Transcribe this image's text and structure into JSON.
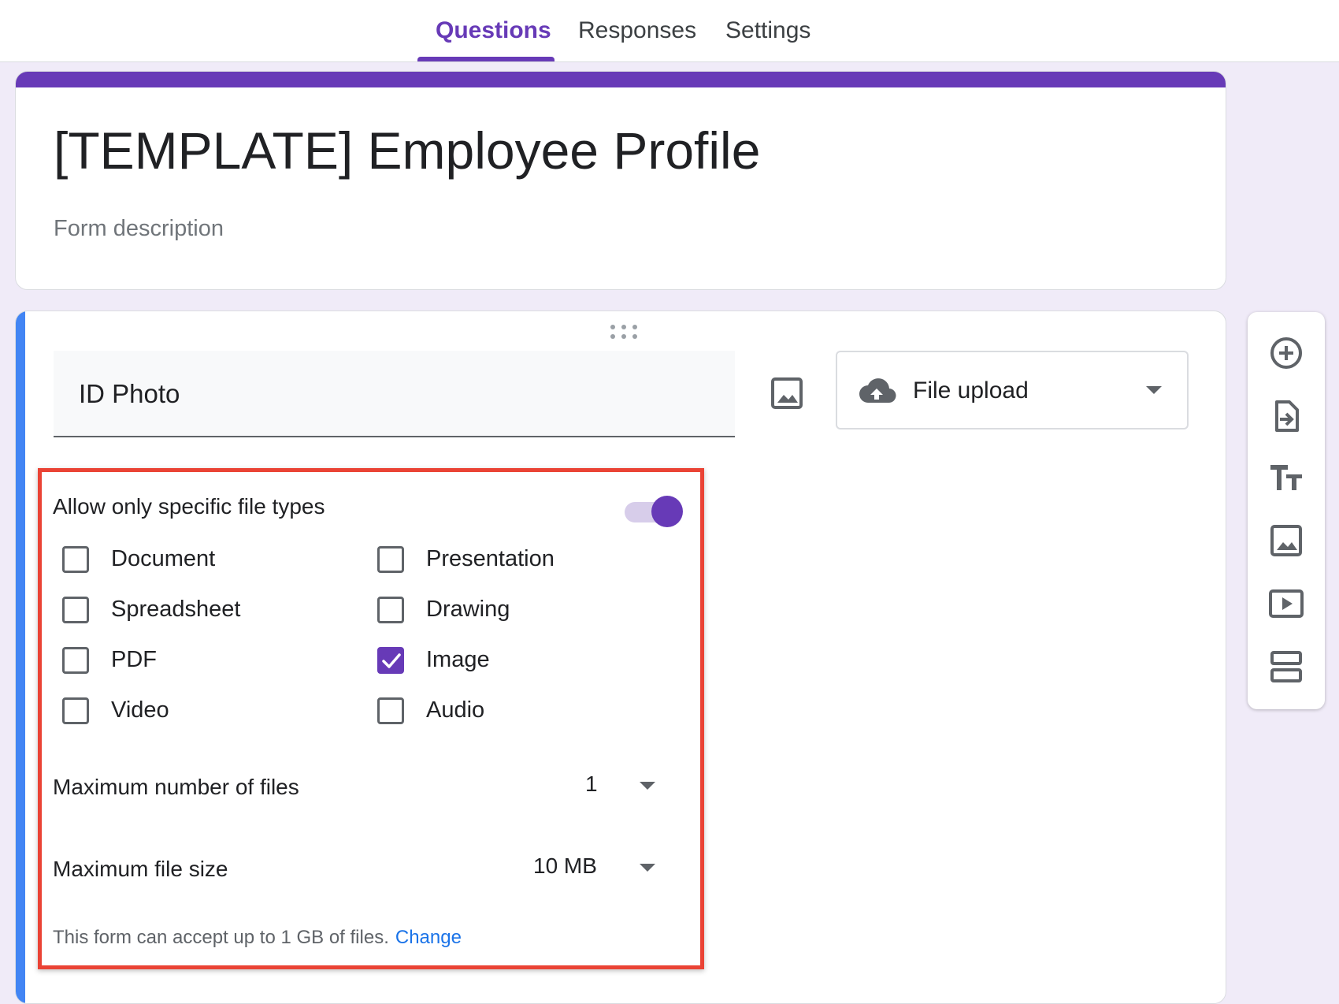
{
  "tabs": [
    {
      "label": "Questions",
      "active": true
    },
    {
      "label": "Responses",
      "active": false
    },
    {
      "label": "Settings",
      "active": false
    }
  ],
  "form": {
    "title": "[TEMPLATE] Employee Profile",
    "description_placeholder": "Form description"
  },
  "question": {
    "title": "ID Photo",
    "type": "File upload",
    "specific_types_label": "Allow only specific file types",
    "specific_types_enabled": true,
    "file_types": [
      {
        "label": "Document",
        "checked": false
      },
      {
        "label": "Presentation",
        "checked": false
      },
      {
        "label": "Spreadsheet",
        "checked": false
      },
      {
        "label": "Drawing",
        "checked": false
      },
      {
        "label": "PDF",
        "checked": false
      },
      {
        "label": "Image",
        "checked": true
      },
      {
        "label": "Video",
        "checked": false
      },
      {
        "label": "Audio",
        "checked": false
      }
    ],
    "max_files_label": "Maximum number of files",
    "max_files_value": "1",
    "max_size_label": "Maximum file size",
    "max_size_value": "10 MB",
    "footer_text": "This form can accept up to 1 GB of files.",
    "footer_link": "Change"
  },
  "colors": {
    "accent": "#673ab7",
    "highlight": "#ea4335",
    "active_question": "#4285f4",
    "link": "#1a73e8"
  },
  "toolbar_icons": [
    "add-question-icon",
    "import-questions-icon",
    "add-title-icon",
    "add-image-icon",
    "add-video-icon",
    "add-section-icon"
  ]
}
